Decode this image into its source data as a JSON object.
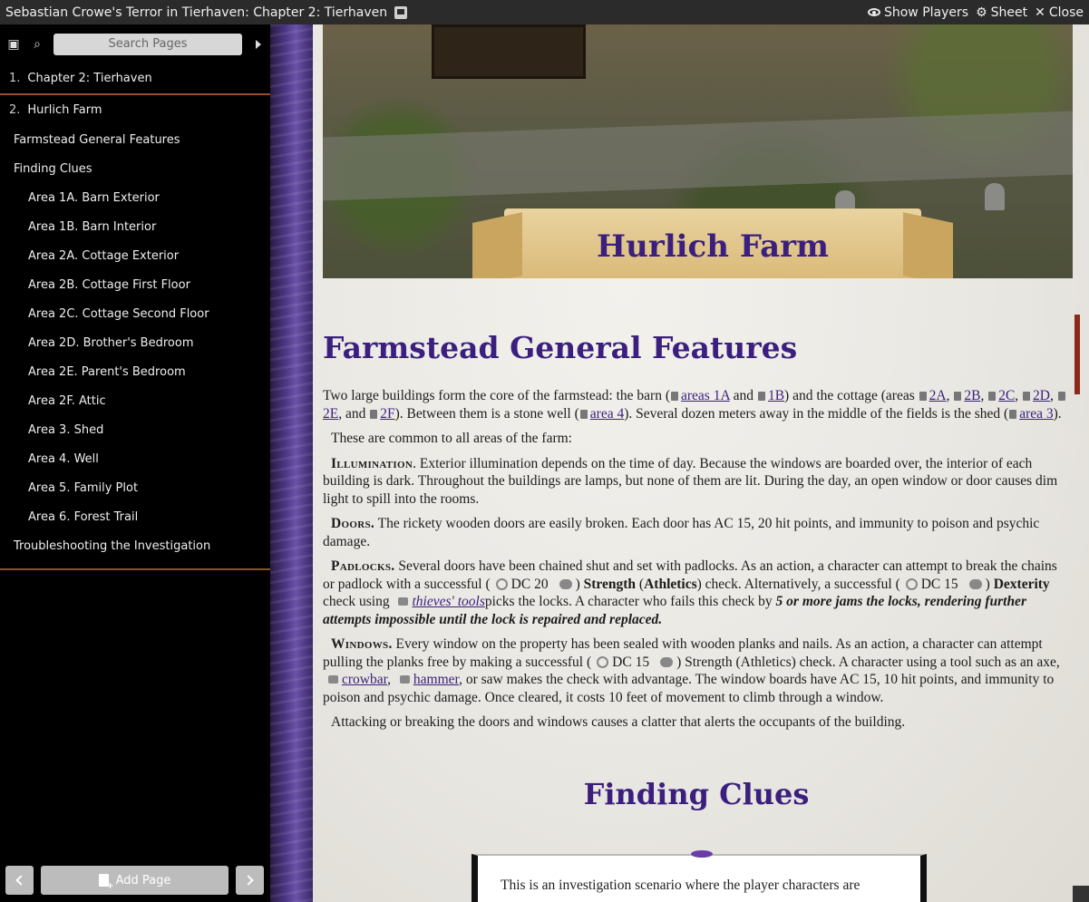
{
  "window": {
    "title": "Sebastian Crowe's Terror in Tierhaven: Chapter 2: Tierhaven",
    "show_players": "Show Players",
    "sheet": "Sheet",
    "close": "Close"
  },
  "sidebar": {
    "search_placeholder": "Search Pages",
    "chapters": [
      {
        "num": "1.",
        "label": "Chapter 2: Tierhaven"
      },
      {
        "num": "2.",
        "label": "Hurlich Farm"
      }
    ],
    "items": [
      {
        "label": "Farmstead General Features",
        "level": "section"
      },
      {
        "label": "Finding Clues",
        "level": "section"
      },
      {
        "label": "Area 1A. Barn Exterior",
        "level": "sub"
      },
      {
        "label": "Area 1B. Barn Interior",
        "level": "sub"
      },
      {
        "label": "Area 2A. Cottage Exterior",
        "level": "sub"
      },
      {
        "label": "Area 2B. Cottage First Floor",
        "level": "sub"
      },
      {
        "label": "Area 2C. Cottage Second Floor",
        "level": "sub"
      },
      {
        "label": "Area 2D. Brother's Bedroom",
        "level": "sub"
      },
      {
        "label": "Area 2E. Parent's Bedroom",
        "level": "sub"
      },
      {
        "label": "Area 2F. Attic",
        "level": "sub"
      },
      {
        "label": "Area 3. Shed",
        "level": "sub"
      },
      {
        "label": "Area 4. Well",
        "level": "sub"
      },
      {
        "label": "Area 5. Family Plot",
        "level": "sub"
      },
      {
        "label": "Area 6. Forest Trail",
        "level": "sub"
      },
      {
        "label": "Troubleshooting the Investigation",
        "level": "section"
      }
    ],
    "add_page": "Add Page"
  },
  "content": {
    "banner_title": "Hurlich Farm",
    "heading1": "Farmstead General Features",
    "intro": {
      "t1": "Two large buildings form the core of the farmstead: the barn (",
      "l1": "areas 1A",
      "t2": " and ",
      "l2": "1B",
      "t3": ") and the cottage (areas ",
      "l3": "2A",
      "t4": ", ",
      "l4": "2B",
      "t5": ", ",
      "l5": "2C",
      "t6": ", ",
      "l6": "2D",
      "t7": ", ",
      "l7": "2E",
      "t8": ", and ",
      "l8": "2F",
      "t9": "). Between them is a stone well (",
      "l9": "area 4",
      "t10": "). Several dozen meters away in the middle of the fields is the shed (",
      "l10": "area 3",
      "t11": ")."
    },
    "common": "These are common to all areas of the farm:",
    "illumination": {
      "label": "Illumination",
      "text": ". Exterior illumination depends on the time of day. Because the windows are boarded over, the interior of each building is dark. Throughout the buildings are lamps, but none of them are lit. During the day, an open window or door causes dim light to spill into the rooms."
    },
    "doors": {
      "label": "Doors.",
      "text": " The rickety wooden doors are easily broken. Each door has AC 15, 20 hit points, and immunity to poison and psychic damage."
    },
    "padlocks": {
      "label": "Padlocks.",
      "t1": " Several doors have been chained shut and set with padlocks. As an action, a character can attempt to break the chains or padlock with a successful (",
      "dc1": "DC 20",
      "t2": ") ",
      "s1": "Strength",
      "t3": " (",
      "s2": "Athletics",
      "t4": ") check. Alternatively, a successful (",
      "dc2": "DC 15",
      "t5": ") ",
      "s3": "Dexterity",
      "t6": " check using ",
      "tool": "thieves' tools",
      "t7": "picks the locks. A character who fails this check by ",
      "emph": "5 or more jams the locks, rendering further attempts impossible until the lock is repaired and replaced."
    },
    "windows": {
      "label": "Windows.",
      "t1": " Every window on the property has been sealed with wooden planks and nails. As an action, a character can attempt pulling the planks free by making a successful (",
      "dc": "DC 15",
      "t2": ") Strength (Athletics) check. A character using a tool such as an axe, ",
      "l1": "crowbar",
      "t3": ", ",
      "l2": "hammer",
      "t4": ", or saw makes the check with advantage. The window boards have AC 15, 10 hit points, and immunity to poison and psychic damage. Once cleared, it costs 10 feet of movement to climb through a window."
    },
    "attacking": "Attacking or breaking the doors and windows causes a clatter that alerts the occupants of the building.",
    "heading2": "Finding Clues",
    "sidebox_text": "This is an investigation scenario where the player characters are"
  },
  "colors": {
    "accent": "#3b1f7e",
    "separator": "#9b4a2e",
    "sidebar_bg": "#000000",
    "titlebar_bg": "#2b2b2b"
  }
}
